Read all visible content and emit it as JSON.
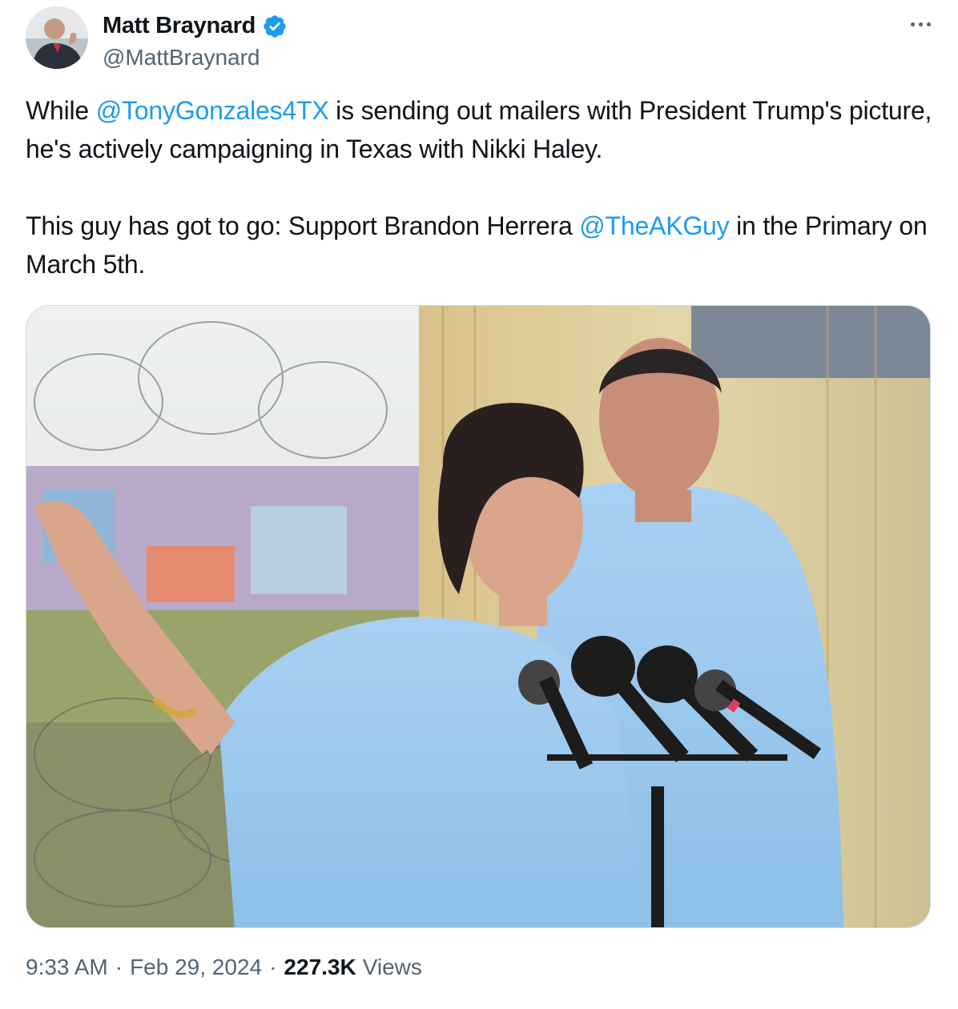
{
  "author": {
    "display_name": "Matt Braynard",
    "handle": "@MattBraynard",
    "verified": true
  },
  "tweet": {
    "para1": {
      "before": "While ",
      "mention": "@TonyGonzales4TX",
      "after": " is sending out mailers with President Trump's picture, he's actively campaigning in Texas with Nikki Haley."
    },
    "para2": {
      "before": "This guy has got to go: Support Brandon Herrera ",
      "mention": "@TheAKGuy",
      "after": " in the Primary on March 5th."
    }
  },
  "meta": {
    "time": "9:33 AM",
    "separator": "·",
    "date": "Feb 29, 2024",
    "views_count": "227.3K",
    "views_label": "Views"
  },
  "colors": {
    "link": "#1d9bf0",
    "secondary_text": "#536471",
    "verified_badge": "#1d9bf0"
  },
  "icons": {
    "verified": "verified-badge-icon",
    "more": "more-dots-icon"
  }
}
